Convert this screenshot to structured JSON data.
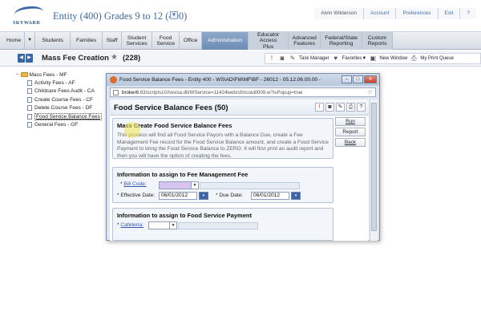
{
  "header": {
    "logo_text": "SKYWARD",
    "entity_title": "Entity (400) Grades 9 to 12 (400)",
    "entity_dropdown_icon": "chevron-down-icon",
    "user_name": "Alvin Wilderson",
    "links": [
      "Account",
      "Preferences",
      "Exit",
      "?"
    ]
  },
  "nav": {
    "items": [
      {
        "label": "Home"
      },
      {
        "label": "Students"
      },
      {
        "label": "Families"
      },
      {
        "label": "Staff"
      },
      {
        "label": "Student Services"
      },
      {
        "label": "Food Service"
      },
      {
        "label": "Office"
      },
      {
        "label": "Administration"
      },
      {
        "label": "Educator Access Plus"
      },
      {
        "label": "Advanced Features"
      },
      {
        "label": "Federal/State Reporting"
      },
      {
        "label": "Custom Reports"
      }
    ],
    "home_arrow": "▼"
  },
  "toolbar": {
    "page_title": "Mass Fee Creation",
    "count": "(228)",
    "task_manager": "Task Manager",
    "favorites": "Favorites▼",
    "new_window": "New Window",
    "print_queue": "My Print Queue"
  },
  "tree": {
    "root": "Mass Fees - MF",
    "items": [
      "Activity Fees - AF",
      "Childcare Fees Audit - CA",
      "Create Course Fees - CF",
      "Delete Course Fees - DF",
      "Food Service Balance Fees",
      "General Fees - GF"
    ]
  },
  "popup": {
    "window_title": "Food Service Balance Fees - Entity 400 - WS\\AD\\FM\\MF\\BF - 26012 - 05.12.06.00.00 -",
    "address_prefix": "broker6",
    "address_rest": ":83/scripts10//wsisa.dll/WService=11424web/sfmcoutil009.w?isPopup=true",
    "heading": "Food Service Balance Fees (50)",
    "mass_title": "Mass Create Food Service Balance Fees",
    "description": "This process will find all Food Service Payors with a Balance Due, create a Fee Management Fee record for the Food Service Balance amount, and create a Food Service Payment to bring the Food Service Balance to ZERO. It will first print an audit report and then you will have the option of creating the fees.",
    "buttons": {
      "run": "Run",
      "report": "Report",
      "back": "Back"
    },
    "fee_section_title": "Information to assign to Fee Management Fee",
    "bill_code_label": "Bill Code:",
    "effective_date_label": "* Effective Date:",
    "effective_date": "06/01/2012",
    "due_date_label": "* Due Date:",
    "due_date": "06/01/2012",
    "payment_section_title": "Information to assign to Food Service Payment",
    "cafeteria_label": "Cafeteria:",
    "asterisk": "*"
  }
}
